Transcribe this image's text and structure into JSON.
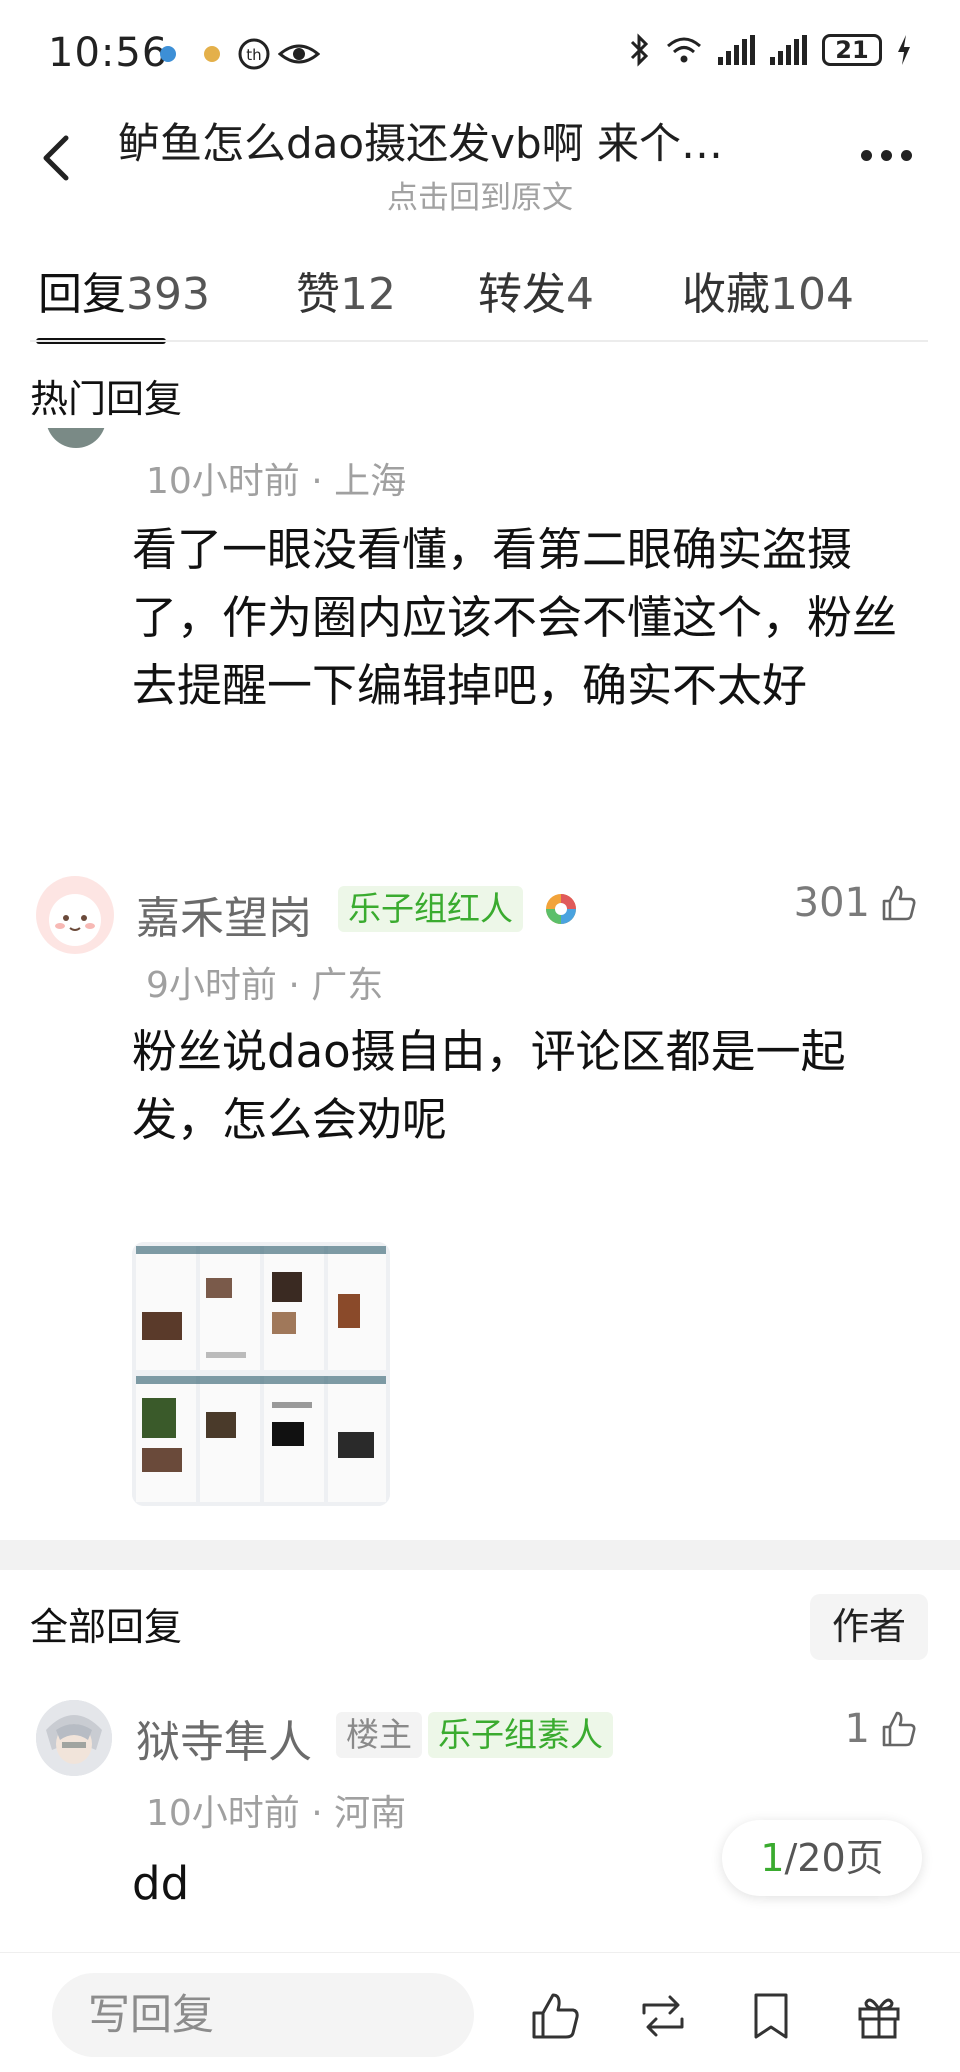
{
  "status_bar": {
    "time": "10:56",
    "battery": "21"
  },
  "header": {
    "title": "鲈鱼怎么dao摄还发vb啊 来个…",
    "subtitle": "点击回到原文"
  },
  "tabs": [
    {
      "label": "回复",
      "count": "393"
    },
    {
      "label": "赞",
      "count": "12"
    },
    {
      "label": "转发",
      "count": "4"
    },
    {
      "label": "收藏",
      "count": "104"
    }
  ],
  "hot": {
    "section_title": "热门回复",
    "first": {
      "meta": "10小时前 · 上海",
      "text": "看了一眼没看懂，看第二眼确实盗摄了，作为圈内应该不会不懂这个，粉丝去提醒一下编辑掉吧，确实不太好"
    },
    "second": {
      "name": "嘉禾望岗",
      "badge": "乐子组红人",
      "likes": "301",
      "meta": "9小时前 · 广东",
      "text": "粉丝说dao摄自由，评论区都是一起发，怎么会劝呢"
    }
  },
  "all": {
    "section_title": "全部回复",
    "author_button": "作者",
    "first": {
      "name": "狱寺隼人",
      "owner_badge": "楼主",
      "badge": "乐子组素人",
      "likes": "1",
      "meta": "10小时前 · 河南",
      "text": "dd"
    }
  },
  "pager": {
    "current": "1",
    "total_label": "/20页"
  },
  "bottom_bar": {
    "placeholder": "写回复"
  },
  "colors": {
    "accent_green": "#3aab2f",
    "badge_bg": "#edf7e8"
  }
}
